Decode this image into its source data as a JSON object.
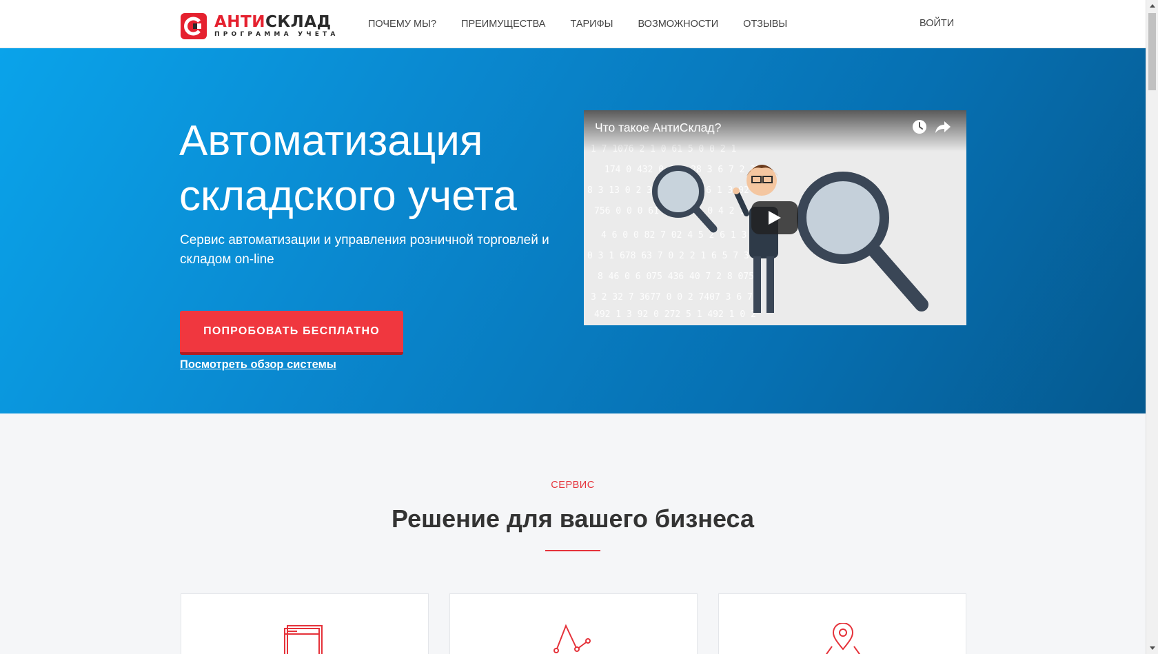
{
  "brand": {
    "logo_part1": "АНТИ",
    "logo_part2": "СКЛАД",
    "logo_subtitle": "ПРОГРАММА УЧЕТА",
    "accent_color": "#e5212f"
  },
  "nav": {
    "items": [
      {
        "label": "ПОЧЕМУ МЫ?"
      },
      {
        "label": "ПРЕИМУЩЕСТВА"
      },
      {
        "label": "ТАРИФЫ"
      },
      {
        "label": "ВОЗМОЖНОСТИ"
      },
      {
        "label": "ОТЗЫВЫ"
      }
    ],
    "login_label": "ВОЙТИ"
  },
  "hero": {
    "title_line1": "Автоматизация",
    "title_line2": "складского учета",
    "subtitle": "Сервис автоматизации и управления розничной торговлей и складом on-line",
    "cta_label": "ПОПРОБОВАТЬ БЕСПЛАТНО",
    "overview_link": "Посмотреть обзор системы",
    "gradient_colors": [
      "#0aa3ea",
      "#05598f"
    ],
    "cta_color": "#f0373f"
  },
  "video": {
    "title": "Что такое АнтиСклад?",
    "icons": [
      "clock-icon",
      "share-icon",
      "play-icon"
    ]
  },
  "service": {
    "tag": "СЕРВИС",
    "title_bold": "Решение",
    "title_rest": " для вашего бизнеса",
    "cards": [
      {
        "icon": "browser-window-icon"
      },
      {
        "icon": "line-chart-icon"
      },
      {
        "icon": "map-pin-icon"
      }
    ]
  }
}
